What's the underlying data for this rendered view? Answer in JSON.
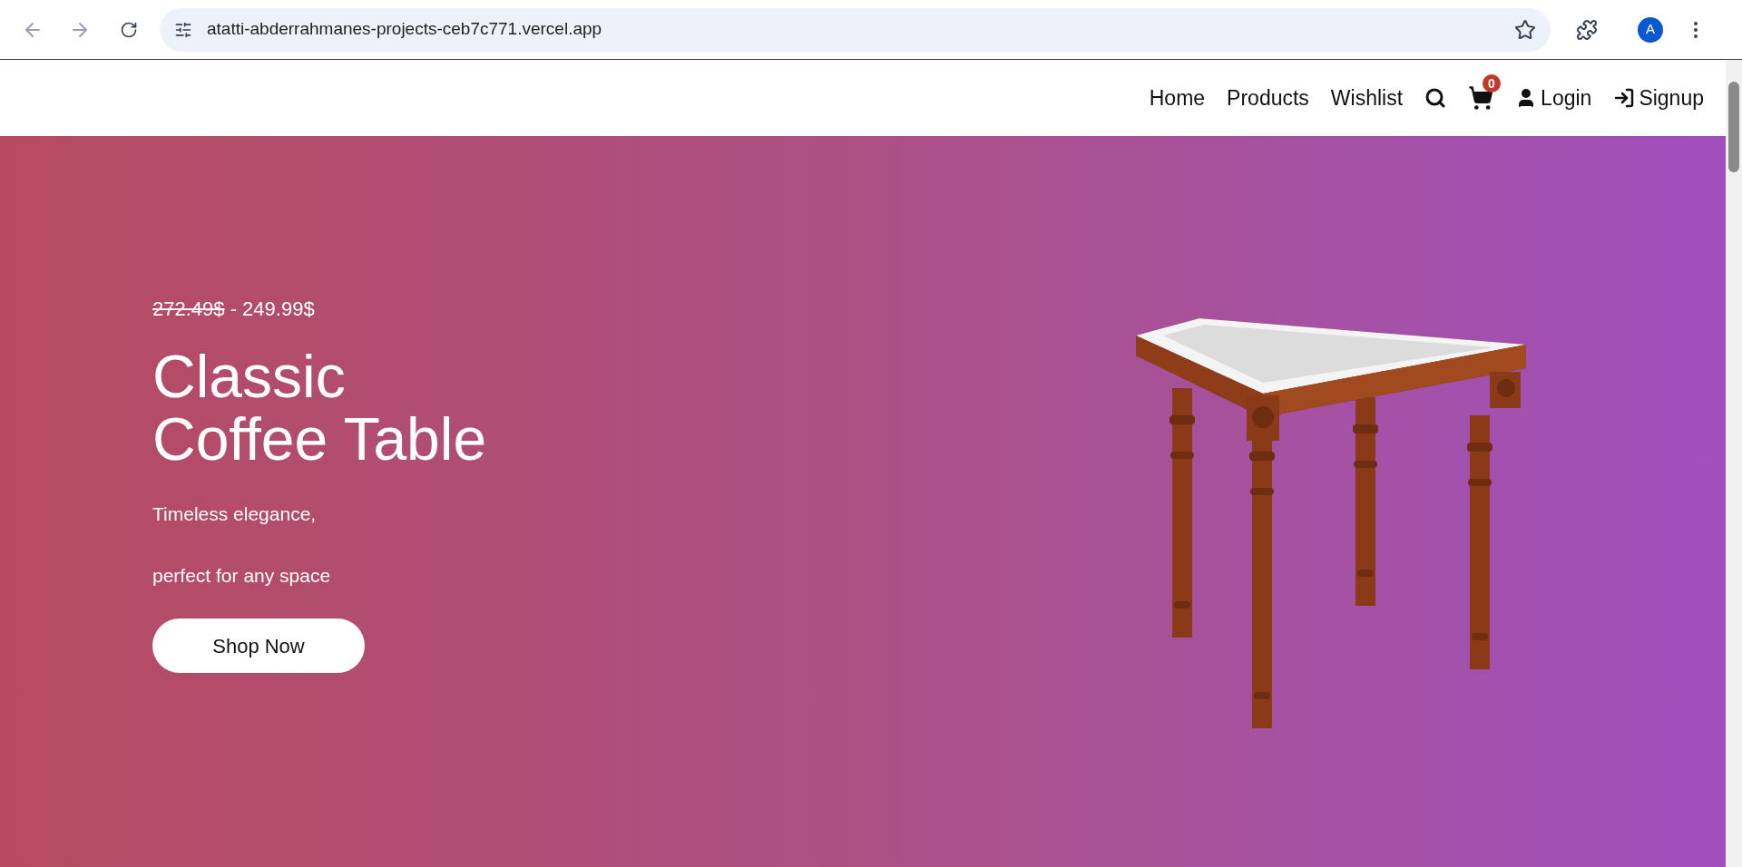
{
  "browser": {
    "url": "atatti-abderrahmanes-projects-ceb7c771.vercel.app",
    "avatar": "A"
  },
  "nav": {
    "links": [
      "Home",
      "Products",
      "Wishlist"
    ],
    "cart_count": "0",
    "login": "Login",
    "signup": "Signup"
  },
  "hero": {
    "old_price": "272.49$",
    "separator": "-",
    "new_price": "249.99$",
    "title_lines": [
      "Classic",
      "Coffee Table"
    ],
    "description_lines": [
      "Timeless elegance,",
      "perfect for any space"
    ],
    "button": "Shop Now"
  }
}
